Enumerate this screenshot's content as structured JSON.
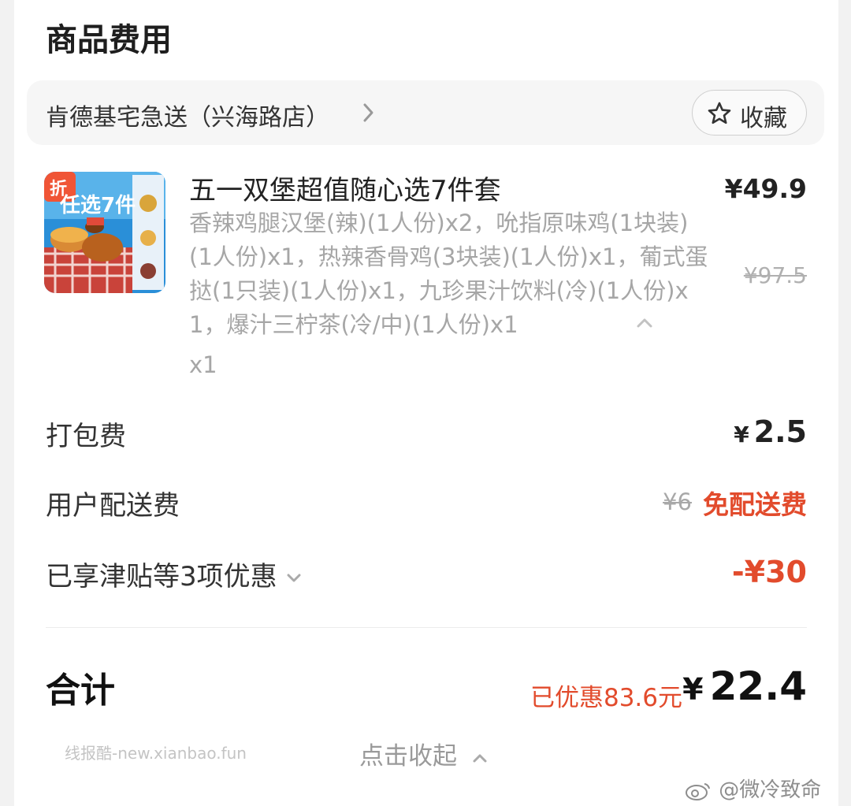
{
  "section": {
    "title": "商品费用"
  },
  "store": {
    "name": "肯德基宅急送（兴海路店）",
    "favorite_label": "收藏"
  },
  "item": {
    "badge": "折",
    "thumb_text": "任选7件",
    "name": "五一双堡超值随心选7件套",
    "description": "香辣鸡腿汉堡(辣)(1人份)x2，吮指原味鸡(1块装)(1人份)x1，热辣香骨鸡(3块装)(1人份)x1，葡式蛋挞(1只装)(1人份)x1，九珍果汁饮料(冷)(1人份)x1，爆汁三柠茶(冷/中)(1人份)x1",
    "quantity": "x1",
    "price": "¥49.9",
    "original_price": "¥97.5"
  },
  "fees": {
    "packing_label": "打包费",
    "packing_yen": "¥",
    "packing_value": "2.5",
    "delivery_label": "用户配送费",
    "delivery_original": "¥6",
    "delivery_value": "免配送费",
    "discount_label": "已享津贴等3项优惠",
    "discount_value": "-¥30"
  },
  "total": {
    "label": "合计",
    "saved_text": "已优惠83.6元",
    "yen": "¥",
    "value": "22.4"
  },
  "footer": {
    "collapse_label": "点击收起",
    "watermark_site": "线报酷-new.xianbao.fun",
    "watermark_user": "@微冷致命"
  },
  "colors": {
    "accent_red": "#e24b2c",
    "muted_text": "#a6a6a6"
  }
}
